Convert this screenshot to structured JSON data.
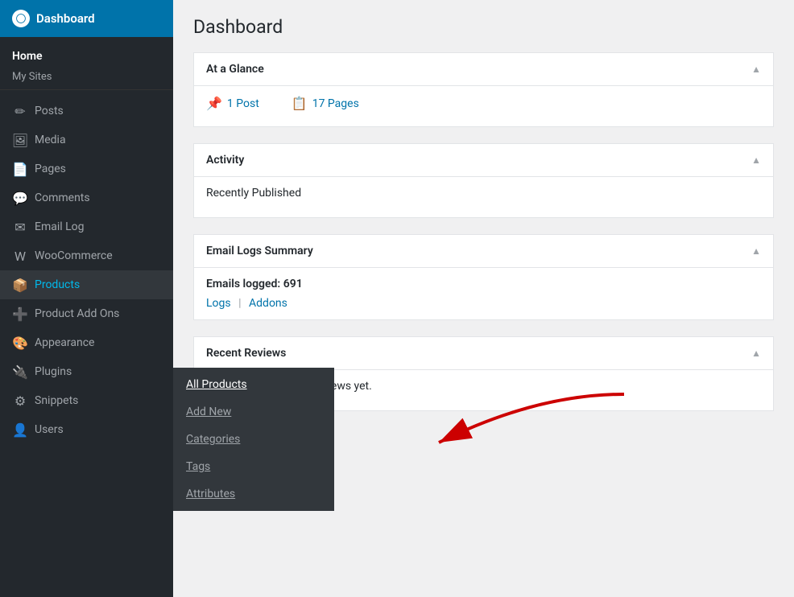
{
  "sidebar": {
    "header": {
      "title": "Dashboard",
      "logo_alt": "WordPress logo"
    },
    "home_section": {
      "home_label": "Home",
      "mysites_label": "My Sites"
    },
    "nav_items": [
      {
        "id": "posts",
        "label": "Posts",
        "icon": "✏"
      },
      {
        "id": "media",
        "label": "Media",
        "icon": "🖼"
      },
      {
        "id": "pages",
        "label": "Pages",
        "icon": "📄"
      },
      {
        "id": "comments",
        "label": "Comments",
        "icon": "💬"
      },
      {
        "id": "email-log",
        "label": "Email Log",
        "icon": "✉"
      },
      {
        "id": "woocommerce",
        "label": "WooCommerce",
        "icon": "W"
      },
      {
        "id": "products",
        "label": "Products",
        "icon": "📦",
        "active": true
      },
      {
        "id": "product-add-ons",
        "label": "Product Add Ons",
        "icon": "➕"
      },
      {
        "id": "appearance",
        "label": "Appearance",
        "icon": "🎨"
      },
      {
        "id": "plugins",
        "label": "Plugins",
        "icon": "🔌"
      },
      {
        "id": "snippets",
        "label": "Snippets",
        "icon": "⚙"
      },
      {
        "id": "users",
        "label": "Users",
        "icon": "👤"
      }
    ]
  },
  "main": {
    "page_title": "Dashboard",
    "widgets": {
      "at_a_glance": {
        "header": "At a Glance",
        "post_count": "1 Post",
        "page_count": "17 Pages"
      },
      "activity": {
        "header": "Activity",
        "recently_published": "Recently Published"
      },
      "email_logs": {
        "header": "Email Logs Summary",
        "emails_logged": "Emails logged: 691",
        "link_logs": "Logs",
        "link_addons": "Addons"
      },
      "recent_reviews": {
        "header": "Recent Reviews",
        "empty_text": "There are no product reviews yet."
      }
    }
  },
  "flyout": {
    "items": [
      {
        "id": "all-products",
        "label": "All Products",
        "first": true
      },
      {
        "id": "add-new",
        "label": "Add New"
      },
      {
        "id": "categories",
        "label": "Categories"
      },
      {
        "id": "tags",
        "label": "Tags"
      },
      {
        "id": "attributes",
        "label": "Attributes"
      }
    ]
  }
}
